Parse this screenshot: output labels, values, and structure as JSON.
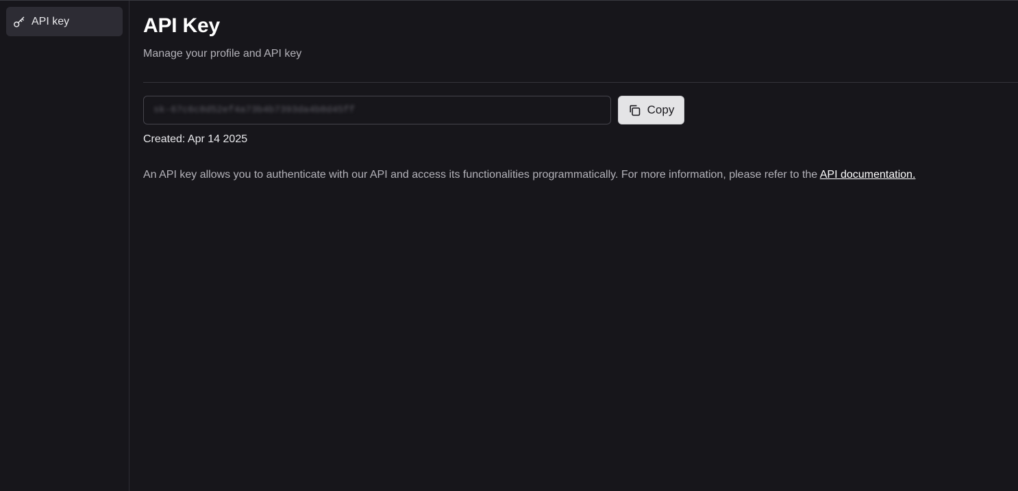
{
  "sidebar": {
    "items": [
      {
        "label": "API key",
        "icon": "key-icon",
        "active": true
      }
    ]
  },
  "header": {
    "title": "API Key",
    "subtitle": "Manage your profile and API key"
  },
  "api_key": {
    "value": "sk-67c6c8d52ef4a73b4b7393da4b0d45ff",
    "copy_label": "Copy",
    "copy_icon": "copy-icon",
    "created": "Created: Apr 14 2025"
  },
  "description": {
    "text": "An API key allows you to authenticate with our API and access its functionalities programmatically. For more information, please refer to the ",
    "link_label": "API documentation."
  },
  "colors": {
    "background": "#17161b",
    "sidebar_active": "#2d2c34",
    "button_bg": "#e4e4e6",
    "text_primary": "#ffffff",
    "text_muted": "#b4b3ba"
  }
}
